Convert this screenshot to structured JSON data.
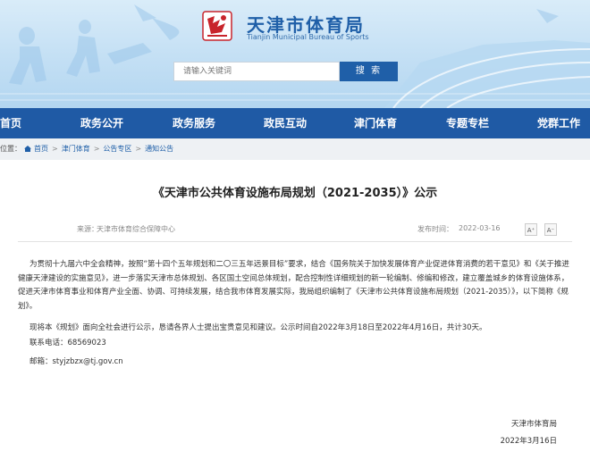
{
  "header": {
    "site_title": "天津市体育局",
    "site_subtitle": "Tianjin Municipal Bureau of Sports",
    "logo_icon": "sports-bureau-logo"
  },
  "search": {
    "placeholder": "请输入关键词",
    "button_label": "搜 索"
  },
  "nav": {
    "items": [
      {
        "label": "首页"
      },
      {
        "label": "政务公开"
      },
      {
        "label": "政务服务"
      },
      {
        "label": "政民互动"
      },
      {
        "label": "津门体育"
      },
      {
        "label": "专题专栏"
      },
      {
        "label": "党群工作"
      }
    ]
  },
  "breadcrumb": {
    "prefix": "位置：",
    "items": [
      "首页",
      "津门体育",
      "公告专区",
      "通知公告"
    ],
    "separator": ">"
  },
  "article": {
    "title": "《天津市公共体育设施布局规划（2021-2035）》公示",
    "source_label": "来源：",
    "source": "天津市体育综合保障中心",
    "date_label": "发布时间：",
    "date": "2022-03-16",
    "font_larger": "A⁺",
    "font_smaller": "A⁻",
    "p1": "为贯彻十九届六中全会精神，按照“第十四个五年规划和二〇三五年远景目标”要求，结合《国务院关于加快发展体育产业促进体育消费的若干意见》和《关于推进健康天津建设的实施意见》，进一步落实天津市总体规划、各区国土空间总体规划，配合控制性详细规划的新一轮编制、修编和修改，建立覆盖城乡的体育设施体系，促进天津市体育事业和体育产业全面、协调、可持续发展，结合我市体育发展实际，我局组织编制了《天津市公共体育设施布局规划（2021-2035）》，以下简称《规划》。",
    "p2": "现将本《规划》面向全社会进行公示，恳请各界人士提出宝贵意见和建议。公示时间自2022年3月18日至2022年4月16日，共计30天。",
    "contact_phone": "联系电话：68569023",
    "contact_email": "邮箱：styjzbzx@tj.gov.cn",
    "signature": "天津市体育局",
    "sign_date": "2022年3月16日"
  },
  "colors": {
    "brand_blue": "#1f5aa5",
    "banner_light": "#c3dff4"
  }
}
